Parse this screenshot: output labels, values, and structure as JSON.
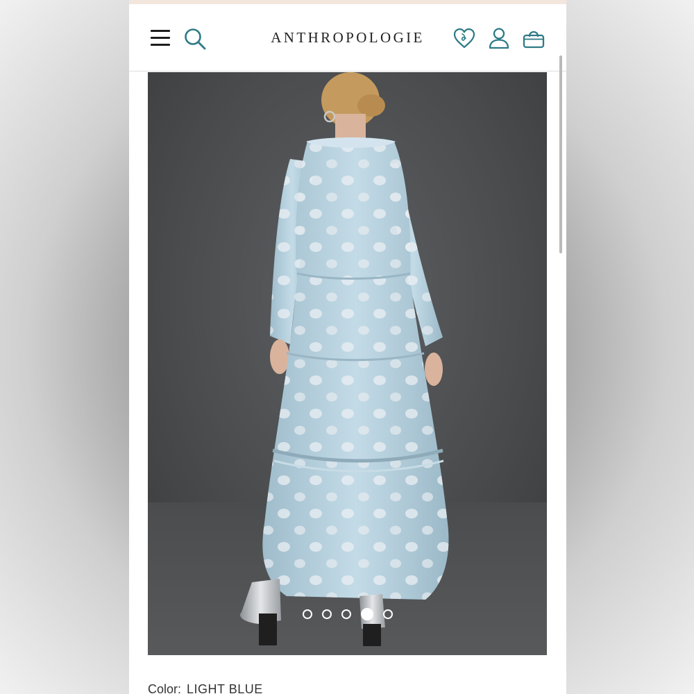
{
  "header": {
    "brand": "ANTHROPOLOGIE",
    "icons": [
      "menu-icon",
      "search-icon",
      "wishlist-heart-icon",
      "account-icon",
      "shopping-bag-icon"
    ]
  },
  "product": {
    "color_label": "Color:",
    "color_value": "LIGHT BLUE"
  },
  "gallery": {
    "total_images": 5,
    "active_index": 3
  },
  "colors": {
    "accent": "#2c7a86",
    "text": "#222222",
    "dress": "#b8d2e0",
    "backdrop": "#4a4c4e"
  }
}
